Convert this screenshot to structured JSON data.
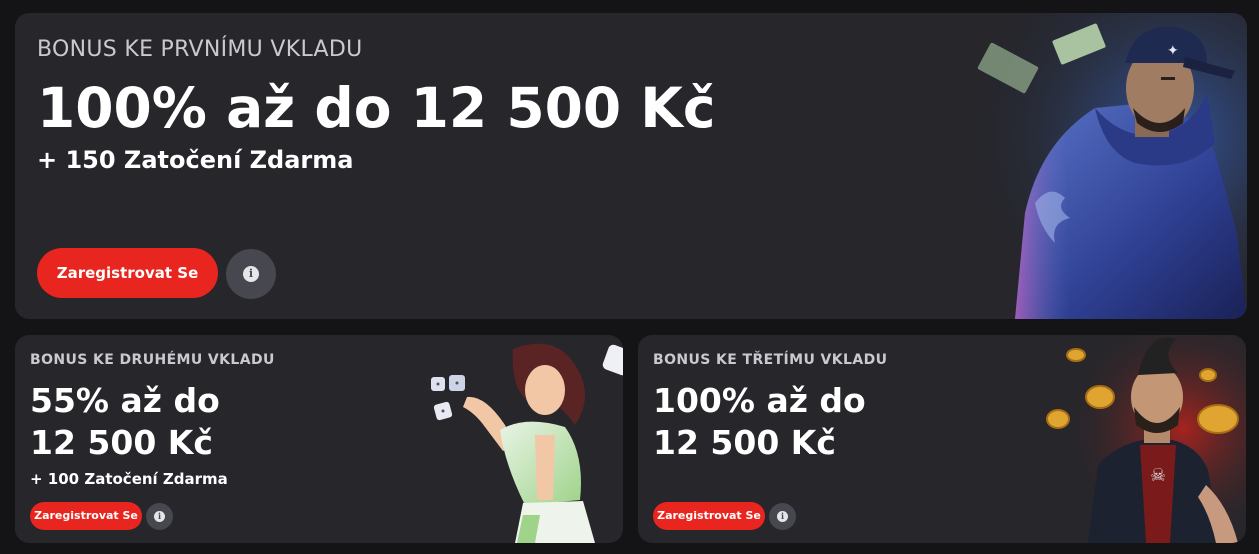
{
  "first_deposit": {
    "eyebrow": "BONUS KE PRVNÍMU VKLADU",
    "headline": "100% až do 12 500 Kč",
    "sub": "+ 150 Zatočení Zdarma",
    "cta": "Zaregistrovat Se",
    "info_icon": "i"
  },
  "second_deposit": {
    "eyebrow": "BONUS KE DRUHÉMU VKLADU",
    "headline_line1": "55% až do",
    "headline_line2": "12 500 Kč",
    "sub": "+ 100 Zatočení Zdarma",
    "cta": "Zaregistrovat Se",
    "info_icon": "i"
  },
  "third_deposit": {
    "eyebrow": "BONUS KE TŘETÍMU VKLADU",
    "headline_line1": "100% až do",
    "headline_line2": "12 500 Kč",
    "cta": "Zaregistrovat Se",
    "info_icon": "i"
  },
  "colors": {
    "card": "#26262b",
    "accent_red": "#e8251e",
    "info_circle": "#47474f"
  }
}
